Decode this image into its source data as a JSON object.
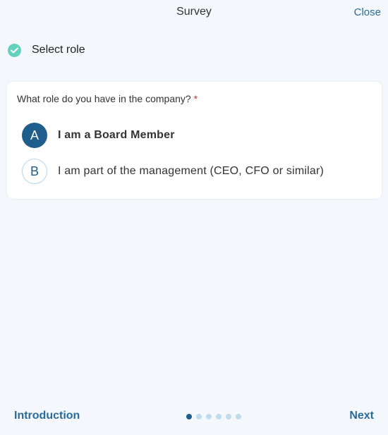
{
  "header": {
    "title": "Survey",
    "close_label": "Close"
  },
  "step": {
    "label": "Select role",
    "status_icon": "check-circle-icon",
    "completed": true
  },
  "question": {
    "text": "What role do you have in the company?",
    "required_marker": "*",
    "options": [
      {
        "key": "A",
        "label": "I am a Board Member",
        "selected": true
      },
      {
        "key": "B",
        "label": "I am part of the management (CEO, CFO or similar)",
        "selected": false
      }
    ]
  },
  "footer": {
    "prev_label": "Introduction",
    "next_label": "Next",
    "page_count": 6,
    "current_page": 1
  },
  "colors": {
    "background": "#f4f8fd",
    "accent": "#1f5d8c",
    "link": "#2a6a99",
    "check": "#62d1bd",
    "dot_inactive": "#bfdcef"
  }
}
